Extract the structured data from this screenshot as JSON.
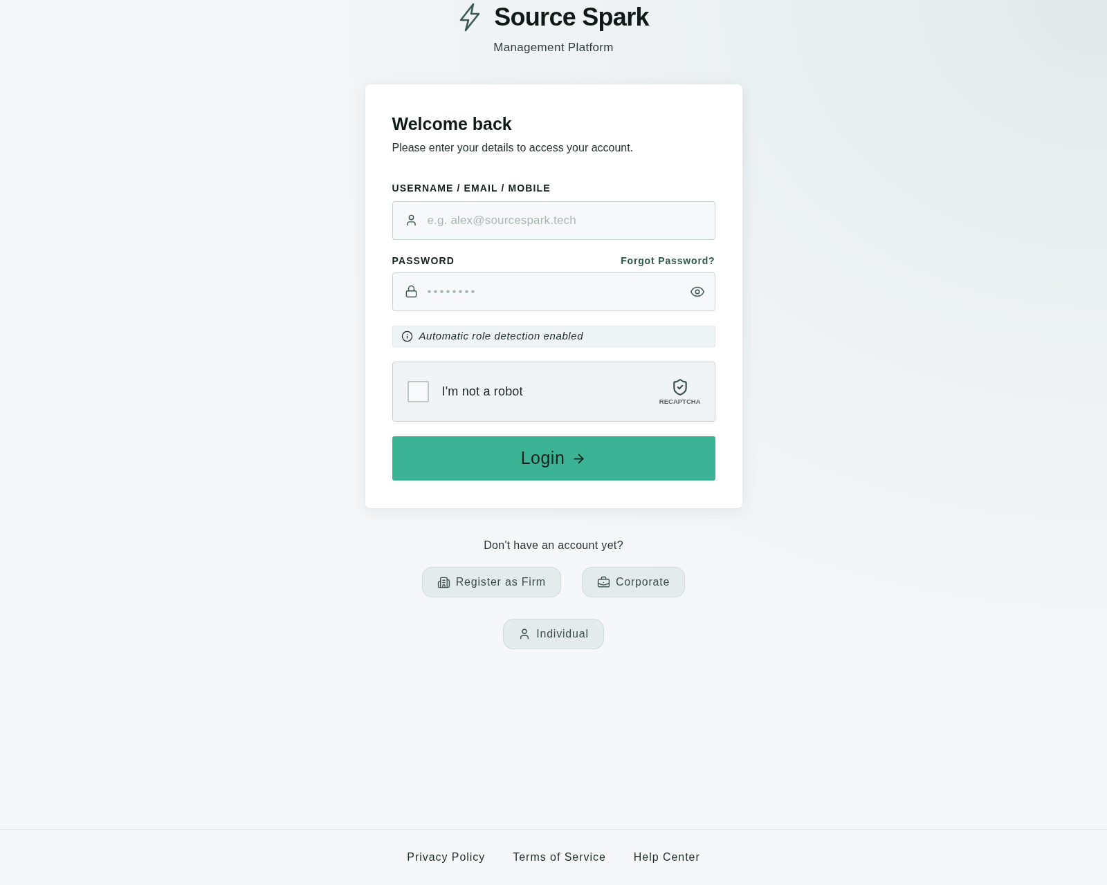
{
  "header": {
    "title": "Source Spark",
    "subtitle": "Management Platform"
  },
  "card": {
    "title": "Welcome back",
    "subtitle": "Please enter your details to access your account.",
    "fields": [
      {
        "kind": "text",
        "label": "USERNAME / EMAIL / MOBILE",
        "placeholder": "e.g. alex@sourcespark.tech"
      },
      {
        "kind": "password",
        "label": "PASSWORD",
        "link": "Forgot Password?",
        "placeholder": "••••••••"
      }
    ],
    "notice": "Automatic role detection enabled",
    "captcha": {
      "label": "I'm not a robot",
      "checked": false,
      "brand": "RECAPTCHA"
    },
    "submit": "Login"
  },
  "signup": {
    "prompt": "Don't have an account yet?",
    "buttons": [
      {
        "kind": "firm",
        "label": "Register as Firm"
      },
      {
        "kind": "corporate",
        "label": "Corporate"
      },
      {
        "kind": "individual",
        "label": "Individual"
      }
    ]
  },
  "footer": {
    "links": [
      "Privacy Policy",
      "Terms of Service",
      "Help Center"
    ]
  }
}
